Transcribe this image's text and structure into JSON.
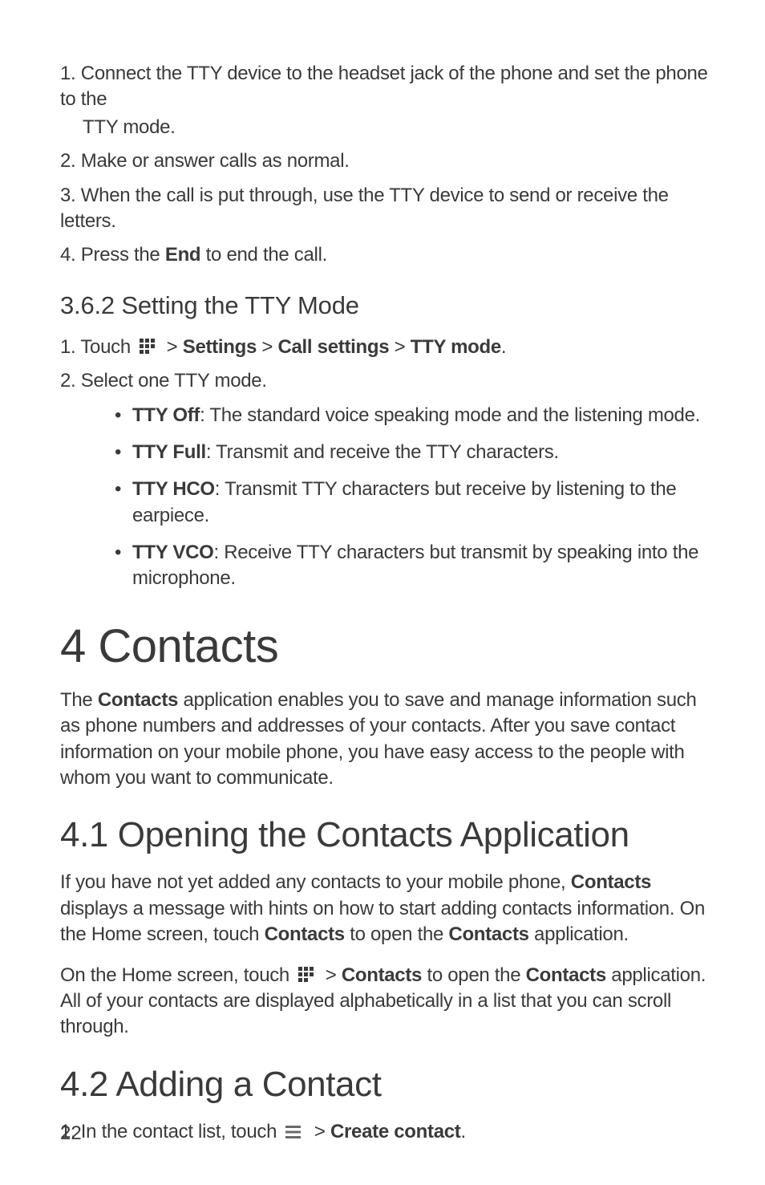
{
  "steps_a": {
    "s1_num": "1.",
    "s1_text": "Connect the TTY device to the headset jack of the phone and set the phone to the",
    "s1_cont": "TTY mode.",
    "s2_num": "2.",
    "s2_text": "Make or answer calls as normal.",
    "s3_num": "3.",
    "s3_text": "When the call is put through, use the TTY device to send or receive the letters.",
    "s4_num": "4.",
    "s4_pre": "Press the ",
    "s4_bold": "End",
    "s4_post": " to end the call."
  },
  "h3_362": "3.6.2  Setting the TTY Mode",
  "steps_b": {
    "s1_num": "1.",
    "s1_pre": "Touch ",
    "s1_gt1": " > ",
    "s1_b1": "Settings",
    "s1_gt2": " > ",
    "s1_b2": "Call settings",
    "s1_gt3": " > ",
    "s1_b3": "TTY mode",
    "s1_end": ".",
    "s2_num": "2.",
    "s2_text": "Select one TTY mode."
  },
  "bullets": {
    "b1_bold": "TTY Off",
    "b1_text": ": The standard voice speaking mode and the listening mode.",
    "b2_bold": "TTY Full",
    "b2_text": ": Transmit and receive the TTY characters.",
    "b3_bold": "TTY HCO",
    "b3_text": ": Transmit TTY characters but receive by listening to the earpiece.",
    "b4_bold": "TTY VCO",
    "b4_text": ": Receive TTY characters but transmit by speaking into the",
    "b4_cont": "microphone."
  },
  "h1_4": "4  Contacts",
  "para_4": {
    "pre": "The ",
    "b1": "Contacts",
    "post": " application enables you to save and manage information such as phone numbers and addresses of your contacts. After you save contact information on your mobile phone, you have easy access to the people with whom you want to communicate."
  },
  "h2_41": "4.1  Opening the Contacts Application",
  "para_41a": {
    "pre": "If you have not yet added any contacts to your mobile phone, ",
    "b1": "Contacts",
    "mid1": " displays a message with hints on how to start adding contacts information. On the Home screen, touch ",
    "b2": "Contacts",
    "mid2": " to open the ",
    "b3": "Contacts",
    "end": " application."
  },
  "para_41b": {
    "pre": "On the Home screen, touch ",
    "gt": " > ",
    "b1": "Contacts",
    "mid": " to open the ",
    "b2": "Contacts",
    "post": " application. All of your contacts are displayed alphabetically in a list that you can scroll through."
  },
  "h2_42": "4.2  Adding a Contact",
  "steps_c": {
    "s1_num": "1.",
    "s1_pre": "In the contact list, touch ",
    "s1_gt": " > ",
    "s1_b": "Create contact",
    "s1_end": "."
  },
  "page_number": "22",
  "icons": {
    "grid": "apps-grid-icon",
    "menu": "menu-icon"
  }
}
